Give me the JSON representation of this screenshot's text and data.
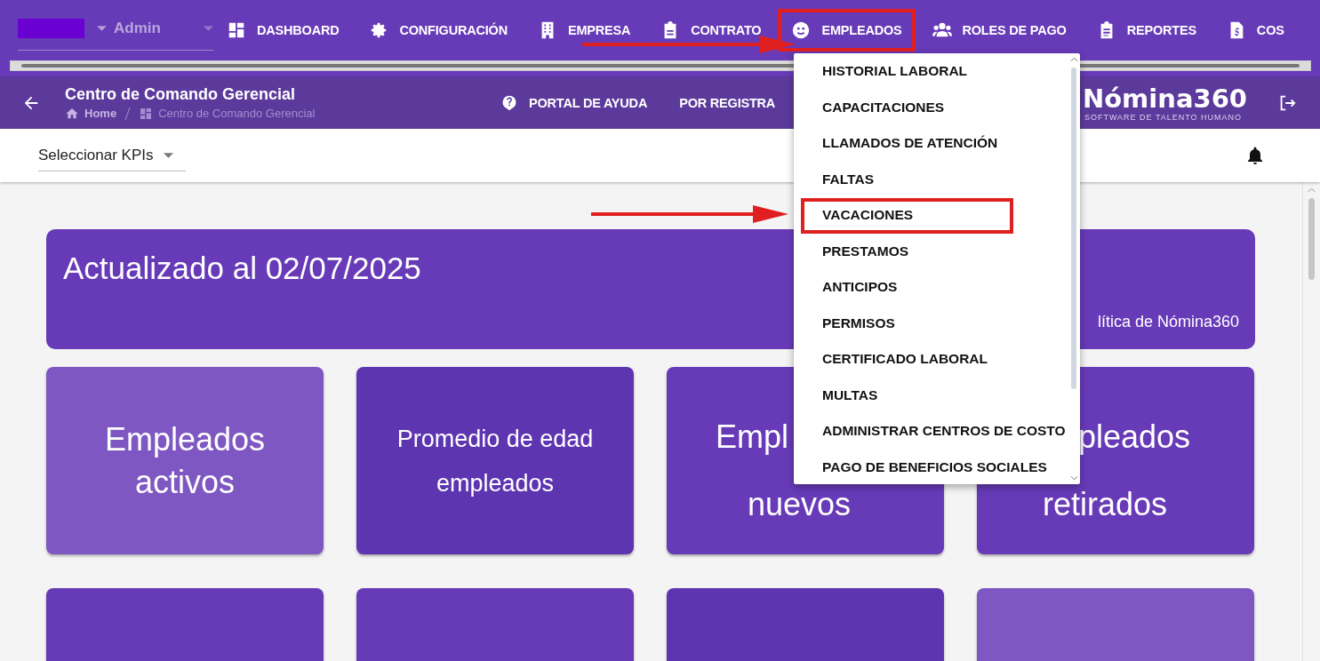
{
  "topbar": {
    "user": "Admin",
    "nav": [
      {
        "label": "DASHBOARD",
        "highlighted": false
      },
      {
        "label": "CONFIGURACIÓN",
        "highlighted": false
      },
      {
        "label": "EMPRESA",
        "highlighted": false
      },
      {
        "label": "CONTRATO",
        "highlighted": false
      },
      {
        "label": "EMPLEADOS",
        "highlighted": true
      },
      {
        "label": "ROLES DE PAGO",
        "highlighted": false
      },
      {
        "label": "REPORTES",
        "highlighted": false
      },
      {
        "label": "COS",
        "highlighted": false
      }
    ]
  },
  "header": {
    "title": "Centro de Comando Gerencial",
    "breadcrumb": [
      "Home",
      "Centro de Comando Gerencial"
    ],
    "links": [
      "PORTAL DE AYUDA",
      "POR REGISTRA"
    ],
    "logo": "Nómina360",
    "logo_tagline": "SOFTWARE DE TALENTO HUMANO"
  },
  "kpi_select": {
    "value": "Seleccionar KPIs"
  },
  "menu": {
    "items": [
      {
        "label": "HISTORIAL LABORAL",
        "highlighted": false
      },
      {
        "label": "CAPACITACIONES",
        "highlighted": false
      },
      {
        "label": "LLAMADOS DE ATENCIÓN",
        "highlighted": false
      },
      {
        "label": "FALTAS",
        "highlighted": false
      },
      {
        "label": "VACACIONES",
        "highlighted": true
      },
      {
        "label": "PRESTAMOS",
        "highlighted": false
      },
      {
        "label": "ANTICIPOS",
        "highlighted": false
      },
      {
        "label": "PERMISOS",
        "highlighted": false
      },
      {
        "label": "CERTIFICADO LABORAL",
        "highlighted": false
      },
      {
        "label": "MULTAS",
        "highlighted": false
      },
      {
        "label": "ADMINISTRAR CENTROS DE COSTO",
        "highlighted": false
      },
      {
        "label": "PAGO DE BENEFICIOS SOCIALES",
        "highlighted": false
      }
    ]
  },
  "banner": {
    "title": "Actualizado al 02/07/2025",
    "subtitle": "lítica de Nómina360"
  },
  "cards": [
    {
      "lines": [
        "Empleados",
        "activos"
      ],
      "color": "#7e57c2"
    },
    {
      "lines": [
        "Promedio de edad",
        "empleados"
      ],
      "color": "#5e35b1"
    },
    {
      "lines": [
        "Empl",
        "nuevos"
      ],
      "color": "#673ab7"
    },
    {
      "lines": [
        "pleados",
        "retirados"
      ],
      "color": "#673ab7"
    },
    {
      "color": "#673ab7"
    },
    {
      "color": "#673ab7"
    },
    {
      "color": "#5e35b1"
    },
    {
      "color": "#7e57c2"
    }
  ]
}
